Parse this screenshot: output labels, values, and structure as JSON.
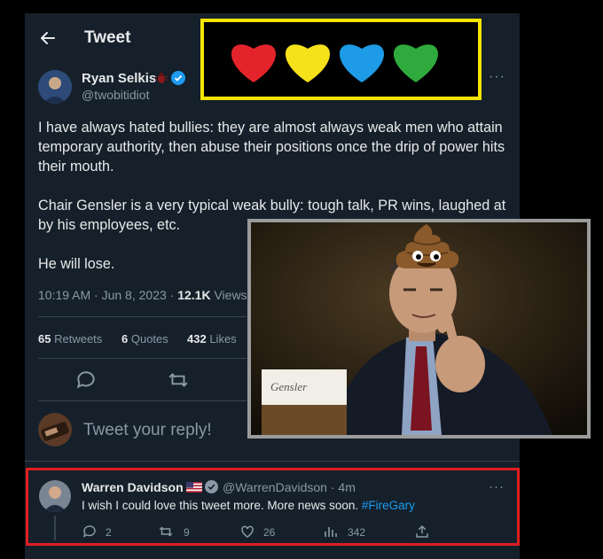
{
  "header": {
    "title": "Tweet"
  },
  "author": {
    "name": "Ryan Selkis",
    "handle": "@twobitidiot"
  },
  "tweet": {
    "paragraphs": [
      "I have always hated bullies: they are almost always weak men who attain temporary authority, then abuse their positions once the drip of power hits their mouth.",
      "Chair Gensler is a very typical weak bully: tough talk, PR wins, laughed at by his employees, etc.",
      "He will lose."
    ],
    "time": "10:19 AM · Jun 8, 2023 ·",
    "views_count": "12.1K",
    "views_label": "Views"
  },
  "stats": {
    "retweets_count": "65",
    "retweets_label": "Retweets",
    "quotes_count": "6",
    "quotes_label": "Quotes",
    "likes_count": "432",
    "likes_label": "Likes"
  },
  "compose": {
    "placeholder": "Tweet your reply!"
  },
  "photo": {
    "nameplate": "Gensler"
  },
  "hearts": {
    "colors": [
      "#e3242b",
      "#f7e11b",
      "#1d9be6",
      "#2faa3c"
    ]
  },
  "reply": {
    "name": "Warren Davidson",
    "handle": "@WarrenDavidson",
    "time": "· 4m",
    "text": "I wish I could love this tweet more. More news soon.",
    "hashtag": "#FireGary",
    "replies": "2",
    "retweets": "9",
    "likes": "26",
    "views": "342"
  },
  "colors": {
    "accent": "#1d9bf0",
    "verified": "#1d9bf0",
    "highlight_yellow": "#f4e400",
    "highlight_red": "#e11d21"
  }
}
